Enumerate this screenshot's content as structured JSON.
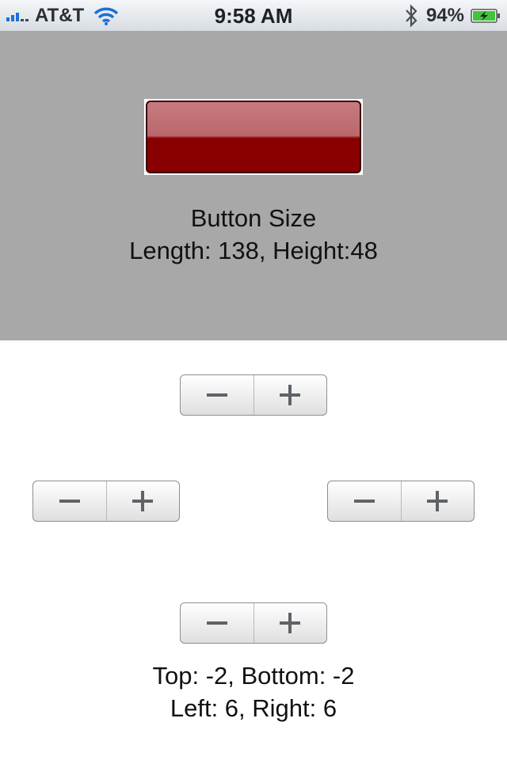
{
  "status_bar": {
    "carrier": "AT&T",
    "time": "9:58 AM",
    "battery_percent": "94%",
    "icons": [
      "signal-icon",
      "wifi-icon",
      "bluetooth-icon",
      "battery-charging-icon"
    ]
  },
  "preview": {
    "button_color": "#8a0000",
    "background_color": "#a8a8a8",
    "size_title": "Button Size",
    "size_values": "Length: 138,  Height:48"
  },
  "steppers": {
    "top": {
      "minus": "−",
      "plus": "+"
    },
    "left": {
      "minus": "−",
      "plus": "+"
    },
    "right": {
      "minus": "−",
      "plus": "+"
    },
    "bottom": {
      "minus": "−",
      "plus": "+"
    }
  },
  "insets": {
    "line1": "Top: -2, Bottom: -2",
    "line2": "Left: 6, Right: 6"
  }
}
